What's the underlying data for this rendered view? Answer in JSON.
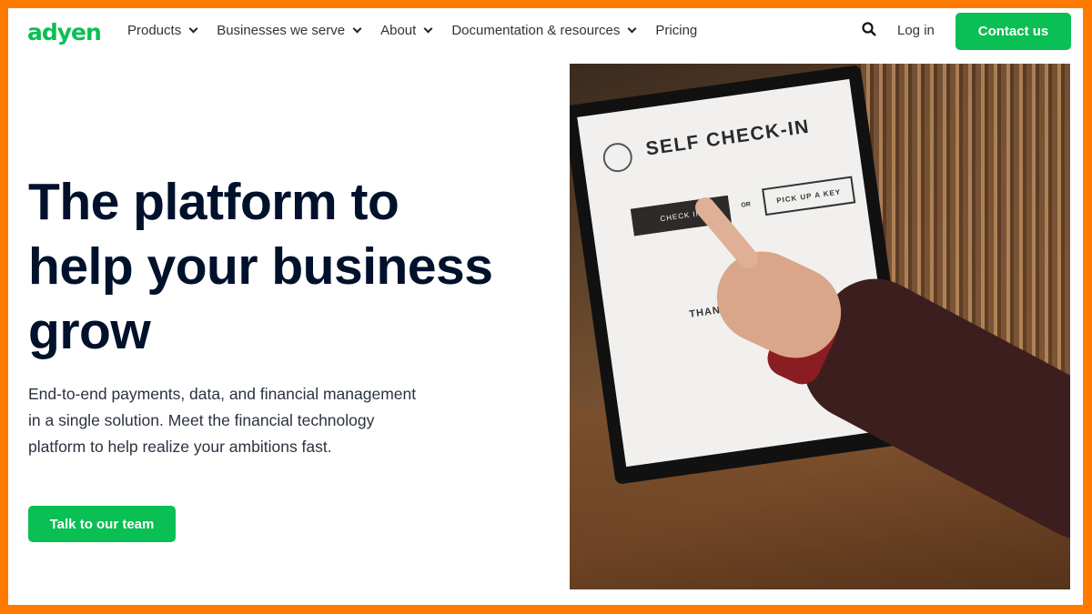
{
  "brand": {
    "logo": "adyen",
    "accent": "#0abf53",
    "border": "#ff7a00"
  },
  "nav": {
    "items": [
      {
        "label": "Products",
        "dropdown": true
      },
      {
        "label": "Businesses we serve",
        "dropdown": true
      },
      {
        "label": "About",
        "dropdown": true
      },
      {
        "label": "Documentation & resources",
        "dropdown": true
      },
      {
        "label": "Pricing",
        "dropdown": false
      }
    ],
    "search_icon": "search-icon",
    "login": "Log in",
    "contact": "Contact us"
  },
  "hero": {
    "title": "The platform to help your business grow",
    "description": "End-to-end payments, data, and financial management in a single solution. Meet the financial technology platform to help realize your ambitions fast.",
    "cta": "Talk to our team"
  },
  "photo": {
    "screen_title": "SELF CHECK-IN",
    "check_in": "CHECK IN",
    "or": "OR",
    "pick_up": "PICK UP A KEY",
    "thank_you": "THANK YOU"
  }
}
